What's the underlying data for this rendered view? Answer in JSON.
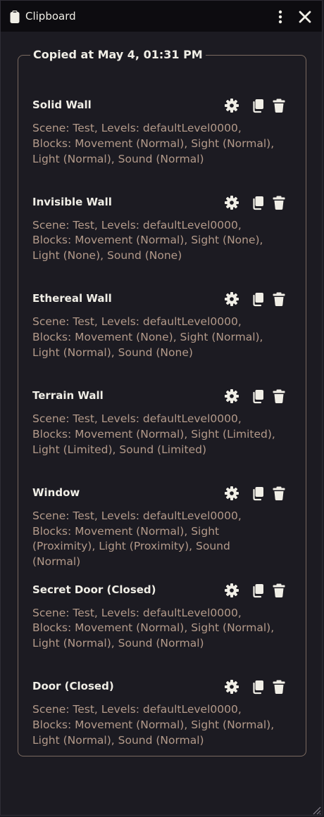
{
  "window": {
    "title": "Clipboard",
    "title_icon": "clipboard-icon",
    "menu_icon": "kebab-menu-icon",
    "close_icon": "close-icon"
  },
  "group": {
    "legend": "Copied at May 4, 01:31 PM"
  },
  "entries": [
    {
      "title": "Solid Wall",
      "description": "Scene: Test, Levels: defaultLevel0000, Blocks: Movement (Normal), Sight (Normal), Light (Normal), Sound (Normal)"
    },
    {
      "title": "Invisible Wall",
      "description": "Scene: Test, Levels: defaultLevel0000, Blocks: Movement (Normal), Sight (None), Light (None), Sound (None)"
    },
    {
      "title": "Ethereal Wall",
      "description": "Scene: Test, Levels: defaultLevel0000, Blocks: Movement (None), Sight (Normal), Light (Normal), Sound (None)"
    },
    {
      "title": "Terrain Wall",
      "description": "Scene: Test, Levels: defaultLevel0000, Blocks: Movement (Normal), Sight (Limited), Light (Limited), Sound (Limited)"
    },
    {
      "title": "Window",
      "description": "Scene: Test, Levels: defaultLevel0000, Blocks: Movement (Normal), Sight (Proximity), Light (Proximity), Sound (Normal)"
    },
    {
      "title": "Secret Door (Closed)",
      "description": "Scene: Test, Levels: defaultLevel0000, Blocks: Movement (Normal), Sight (Normal), Light (Normal), Sound (Normal)"
    },
    {
      "title": "Door (Closed)",
      "description": "Scene: Test, Levels: defaultLevel0000, Blocks: Movement (Normal), Sight (Normal), Light (Normal), Sound (Normal)"
    }
  ],
  "entry_actions": [
    "gear-icon",
    "copy-icon",
    "trash-icon"
  ],
  "colors": {
    "background": "#1c1b22",
    "titlebar": "#0d0c10",
    "text": "#f0eee6",
    "description": "#b39a8a",
    "border": "#7a6a60"
  }
}
